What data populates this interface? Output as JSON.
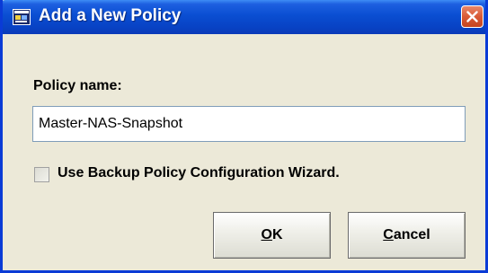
{
  "window": {
    "title": "Add a New Policy",
    "titlebar_color": "#0a4ed2",
    "title_icon": "app-window-icon",
    "close_icon": "close-icon"
  },
  "form": {
    "policy_name_label": "Policy name:",
    "policy_name_value": "Master-NAS-Snapshot",
    "wizard_checkbox_label": "Use Backup Policy Configuration Wizard.",
    "wizard_checkbox_checked": false
  },
  "buttons": {
    "ok": {
      "mnemonic": "O",
      "rest": "K"
    },
    "cancel": {
      "mnemonic": "C",
      "rest": "ancel"
    }
  }
}
